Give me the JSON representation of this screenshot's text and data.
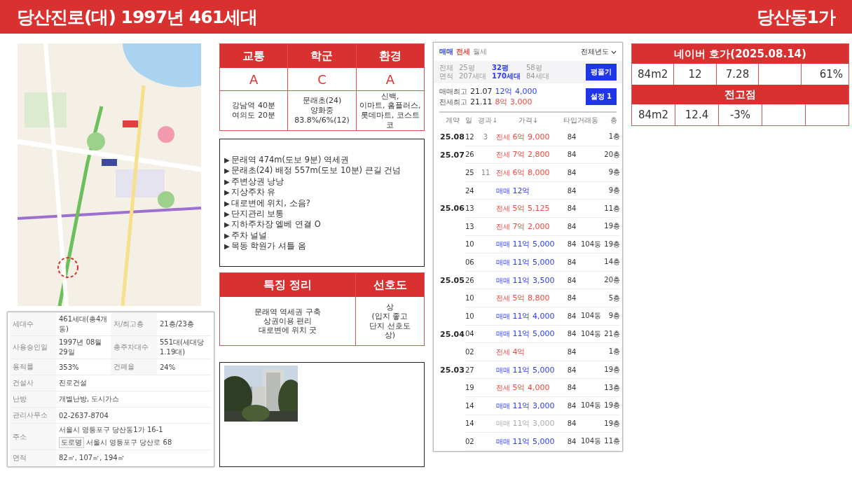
{
  "header": {
    "title": "당산진로(대) 1997년 461세대",
    "region": "당산동1가"
  },
  "info_table": {
    "rows": [
      {
        "items": [
          {
            "label": "세대수",
            "value": [
              "461세대(총4개동)"
            ]
          },
          {
            "label": "저/최고층",
            "value": [
              "21층/23층"
            ]
          }
        ]
      },
      {
        "items": [
          {
            "label": "사용승인일",
            "value": [
              "1997년 08월 29일"
            ]
          },
          {
            "label": "총주차대수",
            "value": [
              "551대(세대당 1.19대)"
            ]
          }
        ]
      },
      {
        "items": [
          {
            "label": "용적률",
            "value": [
              "353%"
            ]
          },
          {
            "label": "건폐율",
            "value": [
              "24%"
            ]
          }
        ]
      },
      {
        "items": [
          {
            "label": "건설사",
            "value": [
              "진로건설"
            ]
          }
        ]
      },
      {
        "items": [
          {
            "label": "난방",
            "value": [
              "개별난방, 도시가스"
            ]
          }
        ]
      },
      {
        "items": [
          {
            "label": "관리사무소",
            "value": [
              "02-2637-8704"
            ]
          }
        ]
      },
      {
        "items": [
          {
            "label": "주소",
            "value": [
              "서울시 영등포구 당산동1가 16-1",
              "서울시 영등포구 당산로 68"
            ],
            "tag": "도로명"
          }
        ]
      },
      {
        "items": [
          {
            "label": "면적",
            "value": [
              "82㎡, 107㎡, 194㎡"
            ]
          }
        ]
      }
    ]
  },
  "grades": {
    "columns": [
      {
        "title": "교통",
        "grade": "A",
        "detail": "강남역 40분\n여의도 20분"
      },
      {
        "title": "학군",
        "grade": "C",
        "detail": "문래초(24)\n양화중\n83.8%/6%(12)"
      },
      {
        "title": "환경",
        "grade": "A",
        "detail": "신백,\n이마트, 홈플러스, 롯데마트, 코스트코"
      }
    ]
  },
  "notes": [
    {
      "marker": "▶",
      "text": "문래역 474m(도보 9분) 역세권"
    },
    {
      "marker": "▶",
      "text": "문래초(24) 배정 557m(도보 10분) 큰길 건넘"
    },
    {
      "marker": "▶",
      "text": "주변상권 낭낭"
    },
    {
      "marker": "▶",
      "text": "지상주차 유"
    },
    {
      "marker": "▶",
      "text": "대로변에 위치, 소음?"
    },
    {
      "marker": "▶",
      "text": "단지관리 보통"
    },
    {
      "marker": "▶",
      "text": "지하주차장 엘베 연결 O"
    },
    {
      "marker": "▶",
      "text": "주차 널널"
    },
    {
      "marker": "▶",
      "text": "목동 학원가 셔틀 옴"
    }
  ],
  "features": {
    "title": "특징 정리",
    "text": "문래역 역세권 구축\n상권이용 편리\n대로변에 위치 굿",
    "pref_title": "선호도",
    "pref_text": "상\n(입지 좋고\n단지 선호도\n상)"
  },
  "transactions": {
    "tabs": [
      {
        "label": "매매",
        "kind": "sale",
        "selected": true
      },
      {
        "label": "전세",
        "kind": "jeonse",
        "selected": true
      },
      {
        "label": "월세",
        "kind": "rent",
        "selected": false
      }
    ],
    "year_filter": "전체년도",
    "area_label": [
      "전체",
      "면적"
    ],
    "areas": [
      {
        "size": "25평",
        "units": "207세대",
        "selected": false
      },
      {
        "size": "32평",
        "units": "170세대",
        "selected": true
      },
      {
        "size": "58평",
        "units": "84세대",
        "selected": false
      }
    ],
    "unfold_button": "평풀기",
    "highs": [
      {
        "label": "매매최고",
        "date": "21.07",
        "price": "12억 4,000",
        "kind": "sale"
      },
      {
        "label": "전세최고",
        "date": "21.11",
        "price": "8억 3,000",
        "kind": "jeonse"
      }
    ],
    "settings_button": "설정 1",
    "columns": [
      "계약",
      "일",
      "경과↓",
      "가격↓",
      "타입",
      "거래동",
      "층"
    ],
    "rows": [
      {
        "month": "25.08",
        "day": "12",
        "elapsed": "3",
        "type": "전세",
        "kind": "jeonse",
        "price": "6억 9,000",
        "area": "84",
        "floor": "1층",
        "cancelled": false
      },
      {
        "month": "25.07",
        "day": "26",
        "type": "전세",
        "kind": "jeonse",
        "price": "7억 2,800",
        "area": "84",
        "floor": "20층",
        "cancelled": false
      },
      {
        "day": "25",
        "elapsed": "11",
        "type": "전세",
        "kind": "jeonse",
        "price": "6억 8,000",
        "area": "84",
        "floor": "9층",
        "cancelled": false
      },
      {
        "day": "24",
        "type": "매매",
        "kind": "sale",
        "price": "12억",
        "area": "84",
        "floor": "9층",
        "cancelled": false
      },
      {
        "month": "25.06",
        "day": "13",
        "type": "전세",
        "kind": "jeonse",
        "price": "5억 5,125",
        "area": "84",
        "floor": "11층",
        "cancelled": false
      },
      {
        "day": "13",
        "type": "전세",
        "kind": "jeonse",
        "price": "7억 2,000",
        "area": "84",
        "floor": "19층",
        "cancelled": false
      },
      {
        "day": "10",
        "type": "매매",
        "kind": "sale",
        "price": "11억 5,000",
        "area": "84",
        "dong": "104동",
        "floor": "19층",
        "cancelled": false
      },
      {
        "day": "06",
        "type": "매매",
        "kind": "sale",
        "price": "11억 5,000",
        "area": "84",
        "floor": "14층",
        "cancelled": false
      },
      {
        "month": "25.05",
        "day": "26",
        "type": "매매",
        "kind": "sale",
        "price": "11억 3,500",
        "area": "84",
        "floor": "20층",
        "cancelled": false
      },
      {
        "day": "10",
        "type": "전세",
        "kind": "jeonse",
        "price": "5억 8,800",
        "area": "84",
        "floor": "5층",
        "cancelled": false
      },
      {
        "day": "10",
        "type": "매매",
        "kind": "sale",
        "price": "11억 4,000",
        "area": "84",
        "dong": "104동",
        "floor": "9층",
        "cancelled": false
      },
      {
        "month": "25.04",
        "day": "04",
        "type": "매매",
        "kind": "sale",
        "price": "11억 5,000",
        "area": "84",
        "dong": "104동",
        "floor": "21층",
        "cancelled": false
      },
      {
        "day": "02",
        "type": "전세",
        "kind": "jeonse",
        "price": "4억",
        "area": "84",
        "floor": "1층",
        "cancelled": false
      },
      {
        "month": "25.03",
        "day": "27",
        "type": "매매",
        "kind": "sale",
        "price": "11억 5,000",
        "area": "84",
        "floor": "19층",
        "cancelled": false
      },
      {
        "day": "19",
        "type": "전세",
        "kind": "jeonse",
        "price": "5억 4,000",
        "area": "84",
        "floor": "13층",
        "cancelled": false
      },
      {
        "day": "14",
        "type": "매매",
        "kind": "sale",
        "price": "11억 3,000",
        "area": "84",
        "dong": "104동",
        "floor": "19층",
        "cancelled": false
      },
      {
        "day": "14",
        "type": "매매",
        "kind": "sale",
        "price": "11억 3,000",
        "area": "84",
        "floor": "19층",
        "cancelled": true
      },
      {
        "day": "02",
        "type": "매매",
        "kind": "sale",
        "price": "11억 5,000",
        "area": "84",
        "dong": "104동",
        "floor": "11층",
        "cancelled": false
      }
    ]
  },
  "price_table": {
    "sections": [
      {
        "title": "네이버 호가(2025.08.14)",
        "cells": [
          "84m2",
          "12",
          "7.28",
          null,
          "61%"
        ]
      },
      {
        "title": "전고점",
        "cells": [
          "84m2",
          "12.4",
          "-3%",
          null,
          null
        ]
      }
    ]
  }
}
